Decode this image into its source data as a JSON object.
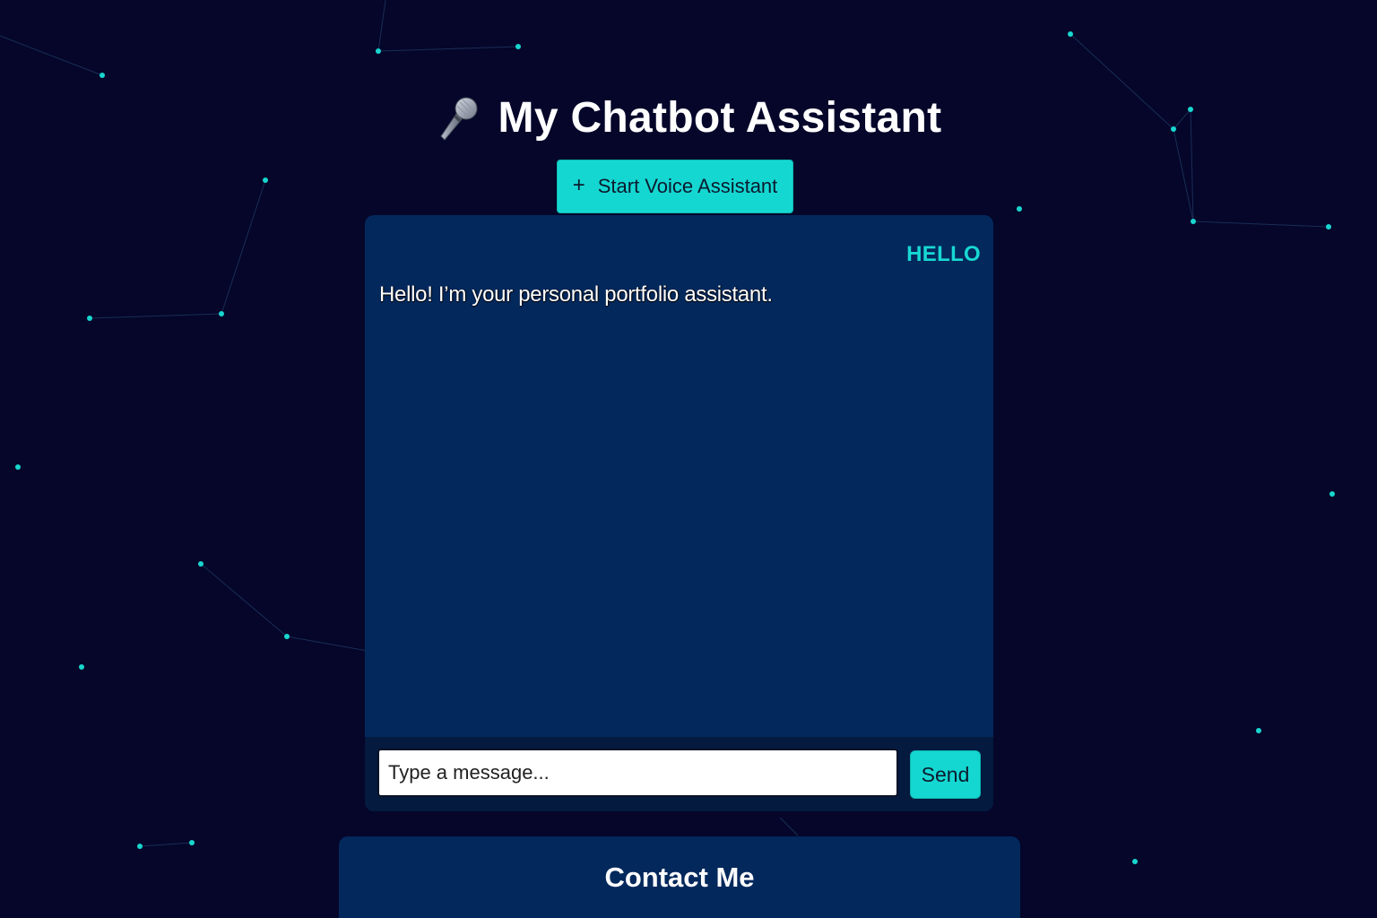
{
  "header": {
    "title": "My Chatbot Assistant",
    "title_icon": "microphone-icon"
  },
  "voice_button": {
    "icon": "plus-icon",
    "icon_glyph": "+",
    "label": "Start Voice Assistant"
  },
  "chat": {
    "messages": [
      {
        "role": "user",
        "text": "HELLO"
      },
      {
        "role": "bot",
        "text": "Hello! I’m your personal portfolio assistant."
      }
    ],
    "input": {
      "value": "",
      "placeholder": "Type a message..."
    },
    "send_label": "Send"
  },
  "contact": {
    "title": "Contact Me"
  },
  "colors": {
    "background": "#05062a",
    "panel": "#03285c",
    "input_bar": "#041a3f",
    "accent": "#15d7d1",
    "node": "#19d6cf"
  }
}
